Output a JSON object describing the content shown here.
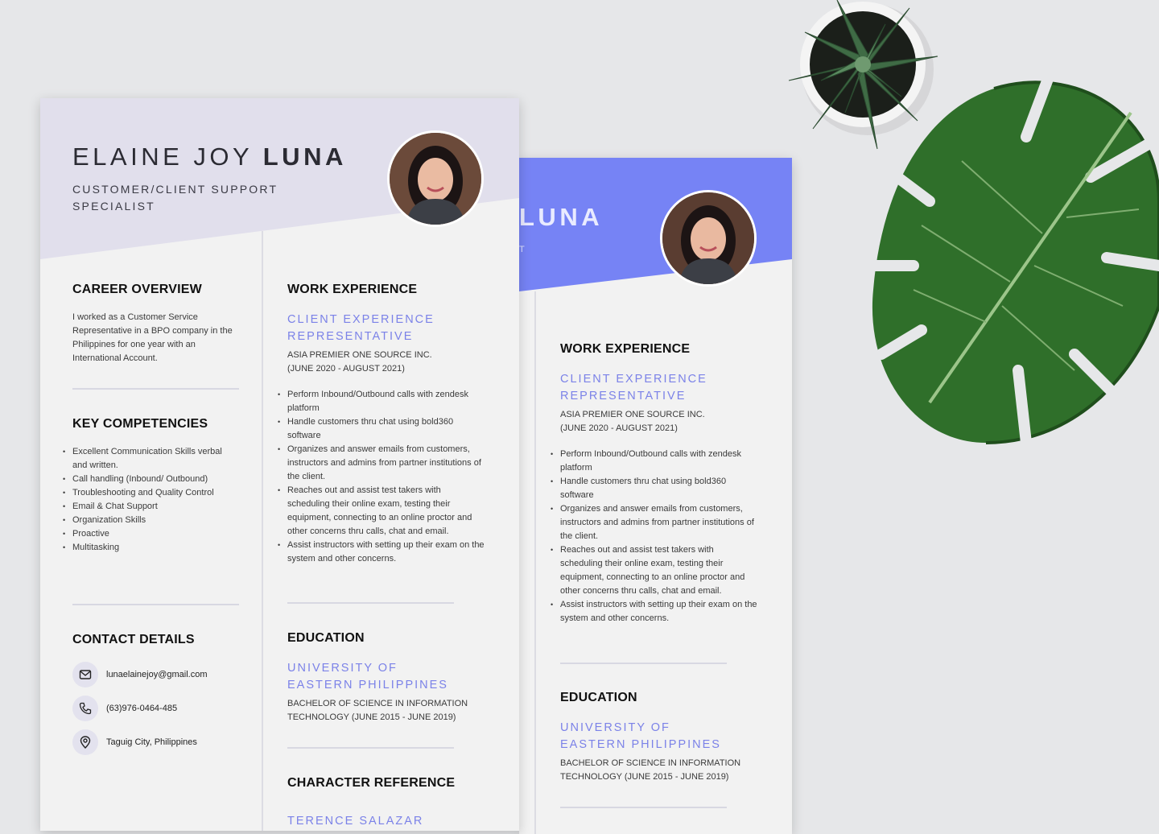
{
  "colors": {
    "page_bg": "#e6e7e9",
    "front_header": "#e1dfec",
    "back_header": "#7683f5",
    "accent_text": "#7b82e8"
  },
  "front": {
    "name_first": "ELAINE JOY",
    "name_last": "LUNA",
    "title": "CUSTOMER/CLIENT SUPPORT SPECIALIST",
    "career": {
      "heading": "CAREER OVERVIEW",
      "text": "I worked as a Customer Service Representative in a BPO company in the  Philippines for one year with an International Account."
    },
    "competencies": {
      "heading": "KEY COMPETENCIES",
      "items": [
        "Excellent Communication Skills verbal and written.",
        "Call handling (Inbound/ Outbound)",
        "Troubleshooting and Quality Control",
        "Email & Chat Support",
        "Organization Skills",
        "Proactive",
        "Multitasking"
      ]
    },
    "contact": {
      "heading": "CONTACT DETAILS",
      "email": "lunaelainejoy@gmail.com",
      "phone": "(63)976-0464-485",
      "location": "Taguig City, Philippines",
      "icons": [
        "mail-icon",
        "phone-icon",
        "location-pin-icon"
      ]
    },
    "work": {
      "heading": "WORK EXPERIENCE",
      "role": "CLIENT EXPERIENCE REPRESENTATIVE",
      "company": "ASIA PREMIER ONE SOURCE INC.",
      "dates": "(JUNE 2020 - AUGUST 2021)",
      "duties": [
        "Perform Inbound/Outbound calls with zendesk platform",
        "Handle customers thru chat using bold360 software",
        "Organizes and answer emails from customers, instructors and admins from partner institutions of the client.",
        "Reaches out and assist test takers with scheduling their online exam, testing their equipment, connecting to an online proctor and other concerns thru calls, chat and email.",
        "Assist instructors with setting up their exam on the system and other concerns."
      ]
    },
    "education": {
      "heading": "EDUCATION",
      "school": "UNIVERSITY OF EASTERN PHILIPPINES",
      "degree": "BACHELOR OF SCIENCE IN INFORMATION TECHNOLOGY (JUNE 2015 - JUNE 2019)"
    },
    "reference": {
      "heading": "CHARACTER REFERENCE",
      "name": "TERENCE SALAZAR"
    }
  },
  "back": {
    "name_last": "LUNA",
    "work": {
      "heading": "WORK EXPERIENCE",
      "role": "CLIENT EXPERIENCE REPRESENTATIVE",
      "company": "ASIA PREMIER ONE SOURCE INC.",
      "dates": "(JUNE 2020 - AUGUST 2021)",
      "duties": [
        "Perform Inbound/Outbound calls with zendesk platform",
        "Handle customers thru chat using bold360 software",
        "Organizes and answer emails from customers, instructors and admins from partner institutions of the client.",
        "Reaches out and assist test takers with scheduling their online exam, testing their equipment, connecting to an online proctor and other concerns thru calls, chat and email.",
        "Assist instructors with setting up their exam on the system and other concerns."
      ]
    },
    "education": {
      "heading": "EDUCATION",
      "school": "UNIVERSITY OF EASTERN PHILIPPINES",
      "degree": "BACHELOR OF SCIENCE IN INFORMATION TECHNOLOGY (JUNE 2015 - JUNE 2019)"
    }
  }
}
